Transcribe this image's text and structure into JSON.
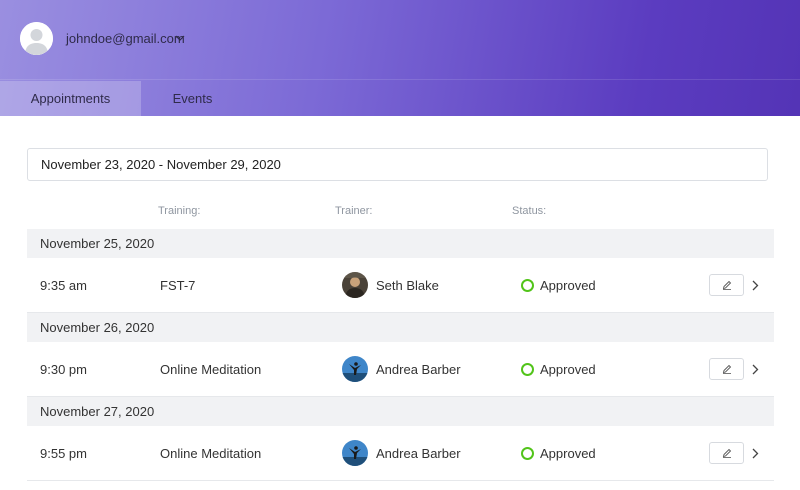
{
  "header": {
    "user_email": "johndoe@gmail.com",
    "avatar_icon": "user-avatar-icon",
    "dropdown_icon": "chevron-down-icon"
  },
  "tabs": [
    {
      "label": "Appointments",
      "active": true
    },
    {
      "label": "Events",
      "active": false
    }
  ],
  "filter": {
    "date_range": "November 23, 2020 - November 29, 2020"
  },
  "columns": {
    "training": "Training:",
    "trainer": "Trainer:",
    "status": "Status:"
  },
  "groups": [
    {
      "date": "November 25, 2020",
      "appointments": [
        {
          "time": "9:35 am",
          "training": "FST-7",
          "trainer": "Seth Blake",
          "status": "Approved"
        }
      ]
    },
    {
      "date": "November 26, 2020",
      "appointments": [
        {
          "time": "9:30 pm",
          "training": "Online Meditation",
          "trainer": "Andrea Barber",
          "status": "Approved"
        }
      ]
    },
    {
      "date": "November 27, 2020",
      "appointments": [
        {
          "time": "9:55 pm",
          "training": "Online Meditation",
          "trainer": "Andrea Barber",
          "status": "Approved"
        }
      ]
    }
  ],
  "colors": {
    "status_approved": "#52c41a",
    "header_gradient_start": "#9a8fe0",
    "header_gradient_end": "#5434b6"
  }
}
